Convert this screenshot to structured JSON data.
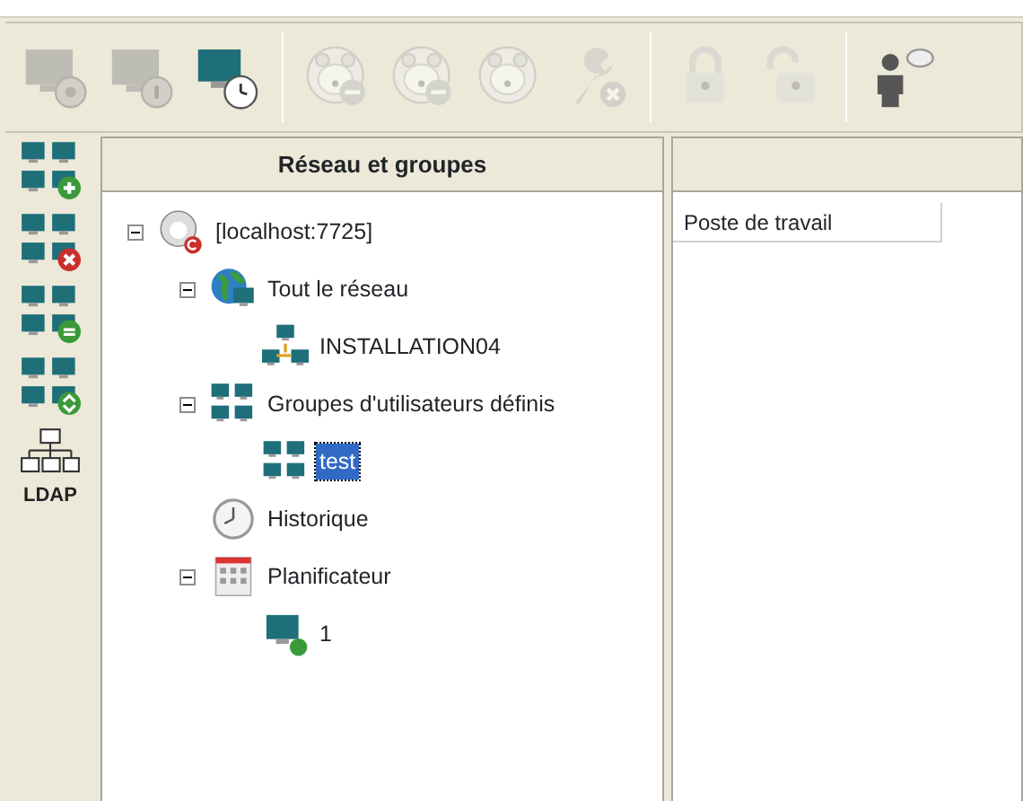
{
  "toolbar": {
    "groups": [
      {
        "buttons": [
          {
            "kind": "computer-gear",
            "disabled": true
          },
          {
            "kind": "computer-info",
            "disabled": true
          },
          {
            "kind": "computer-alarm",
            "disabled": false
          }
        ]
      },
      {
        "buttons": [
          {
            "kind": "bear-minus",
            "disabled": true
          },
          {
            "kind": "bear-minus-lock",
            "disabled": true
          },
          {
            "kind": "bear",
            "disabled": true
          },
          {
            "kind": "wrench-x",
            "disabled": true
          }
        ]
      },
      {
        "buttons": [
          {
            "kind": "lock",
            "disabled": true
          },
          {
            "kind": "unlock",
            "disabled": true
          }
        ]
      },
      {
        "buttons": [
          {
            "kind": "person-chat",
            "disabled": false
          }
        ]
      }
    ]
  },
  "side_toolbar": [
    {
      "kind": "group-add"
    },
    {
      "kind": "group-remove"
    },
    {
      "kind": "group-sync"
    },
    {
      "kind": "group-move"
    },
    {
      "kind": "ldap",
      "label": "LDAP"
    }
  ],
  "tree_panel": {
    "header": "Réseau et groupes",
    "tree": [
      {
        "label": "[localhost:7725]",
        "kind": "server",
        "expanded": true,
        "selected": false,
        "children": [
          {
            "label": "Tout le réseau",
            "kind": "globe",
            "expanded": true,
            "selected": false,
            "children": [
              {
                "label": "INSTALLATION04",
                "kind": "network",
                "selected": false
              }
            ]
          },
          {
            "label": "Groupes d'utilisateurs définis",
            "kind": "group",
            "expanded": true,
            "selected": false,
            "children": [
              {
                "label": "test",
                "kind": "group",
                "selected": true
              }
            ]
          },
          {
            "label": "Historique",
            "kind": "clock",
            "selected": false
          },
          {
            "label": "Planificateur",
            "kind": "calendar",
            "expanded": true,
            "selected": false,
            "children": [
              {
                "label": "1",
                "kind": "computer",
                "selected": false
              }
            ]
          }
        ]
      }
    ]
  },
  "list_panel": {
    "columns": [
      "Poste de travail"
    ]
  }
}
